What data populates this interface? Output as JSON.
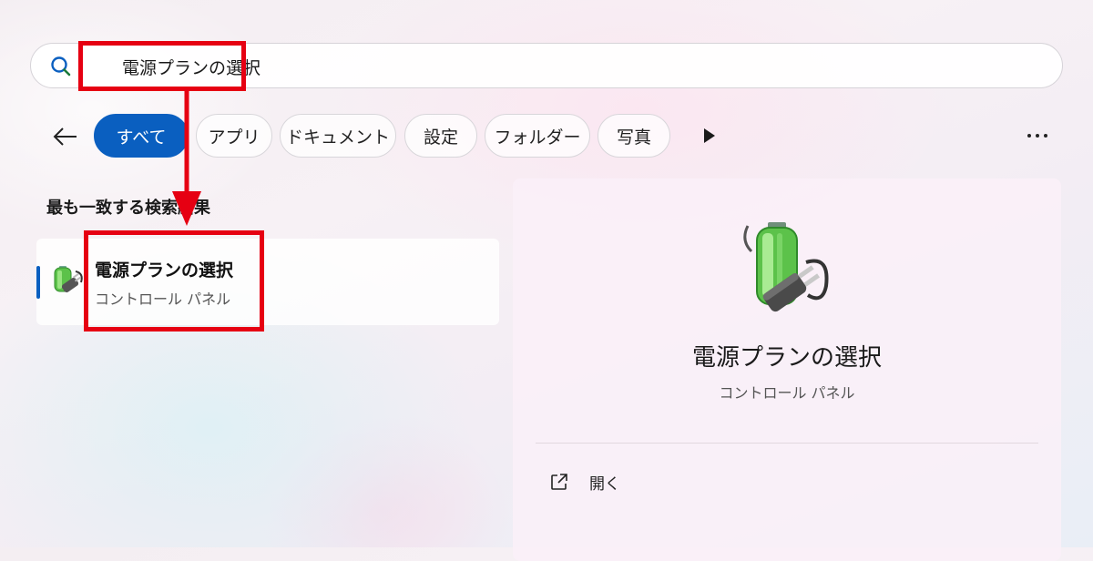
{
  "search": {
    "value": "電源プランの選択",
    "icon": "search-icon"
  },
  "filters": [
    {
      "label": "すべて",
      "active": true
    },
    {
      "label": "アプリ",
      "active": false
    },
    {
      "label": "ドキュメント",
      "active": false
    },
    {
      "label": "設定",
      "active": false
    },
    {
      "label": "フォルダー",
      "active": false
    },
    {
      "label": "写真",
      "active": false
    }
  ],
  "best_match": {
    "section_title": "最も一致する検索結果",
    "item": {
      "title": "電源プランの選択",
      "subtitle": "コントロール パネル",
      "icon": "power-battery-icon"
    }
  },
  "detail": {
    "title": "電源プランの選択",
    "subtitle": "コントロール パネル",
    "icon": "power-battery-icon",
    "actions": [
      {
        "label": "開く",
        "icon": "open-external-icon"
      }
    ]
  },
  "colors": {
    "accent": "#0a5fc0",
    "annotation": "#e60012"
  }
}
